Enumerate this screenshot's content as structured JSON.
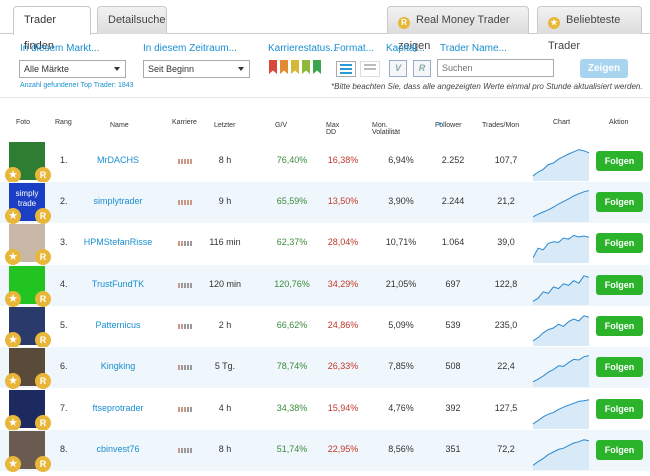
{
  "tabs": {
    "trader_finden": "Trader finden",
    "detailsuche": "Detailsuche",
    "real_money": "Real Money Trader zeigen",
    "beliebteste": "Beliebteste Trader",
    "real_badge": "R"
  },
  "filters": {
    "markt_label": "In diesem Markt...",
    "markt_value": "Alle Märkte",
    "zeitraum_label": "In diesem Zeitraum...",
    "zeitraum_value": "Seit Beginn",
    "karriere_label": "Karrierestatus...",
    "format_label": "Format...",
    "kapital_label": "Kapital...",
    "trader_name_label": "Trader Name...",
    "search_placeholder": "Suchen",
    "zeigen": "Zeigen",
    "anzahl": "Anzahl gefundener Top Trader: 1843",
    "note": "*Bitte beachten Sie, dass alle angezeigten Werte einmal pro Stunde aktualisiert werden.",
    "kapital_v": "V",
    "kapital_r": "R"
  },
  "columns": {
    "foto": "Foto",
    "rang": "Rang",
    "name": "Name",
    "karriere": "Karriere",
    "letzter": "Letzter",
    "gv": "G/V",
    "maxdd": "Max DD",
    "volatil": "Mon. Volatilität",
    "follower": "Follower",
    "trades": "Trades/Mon",
    "chart": "Chart",
    "aktion": "Aktion"
  },
  "rows": [
    {
      "rang": "1.",
      "name": "MrDACHS",
      "letzter": "8 h",
      "gv": "76,40%",
      "maxdd": "16,38%",
      "volatil": "6,94%",
      "follower": "2.252",
      "trades": "107,7",
      "action": "Folgen",
      "photo_color": "#2e7d32"
    },
    {
      "rang": "2.",
      "name": "simplytrader",
      "letzter": "9 h",
      "gv": "65,59%",
      "maxdd": "13,50%",
      "volatil": "3,90%",
      "follower": "2.244",
      "trades": "21,2",
      "action": "Folgen",
      "photo_color": "#1a3fc4",
      "photo_text": "simply trade"
    },
    {
      "rang": "3.",
      "name": "HPMStefanRisse",
      "letzter": "116 min",
      "gv": "62,37%",
      "maxdd": "28,04%",
      "volatil": "10,71%",
      "follower": "1.064",
      "trades": "39,0",
      "action": "Folgen",
      "photo_color": "#c9b8a8"
    },
    {
      "rang": "4.",
      "name": "TrustFundTK",
      "letzter": "120 min",
      "gv": "120,76%",
      "maxdd": "34,29%",
      "volatil": "21,05%",
      "follower": "697",
      "trades": "122,8",
      "action": "Folgen",
      "photo_color": "#22c422"
    },
    {
      "rang": "5.",
      "name": "Patternicus",
      "letzter": "2 h",
      "gv": "66,62%",
      "maxdd": "24,86%",
      "volatil": "5,09%",
      "follower": "539",
      "trades": "235,0",
      "action": "Folgen",
      "photo_color": "#2a3a6a"
    },
    {
      "rang": "6.",
      "name": "Kingking",
      "letzter": "5 Tg.",
      "gv": "78,74%",
      "maxdd": "26,33%",
      "volatil": "7,85%",
      "follower": "508",
      "trades": "22,4",
      "action": "Folgen",
      "photo_color": "#5a4a3a"
    },
    {
      "rang": "7.",
      "name": "ftseprotrader",
      "letzter": "4 h",
      "gv": "34,38%",
      "maxdd": "15,94%",
      "volatil": "4,76%",
      "follower": "392",
      "trades": "127,5",
      "action": "Folgen",
      "photo_color": "#1c2a60"
    },
    {
      "rang": "8.",
      "name": "cbinvest76",
      "letzter": "8 h",
      "gv": "51,74%",
      "maxdd": "22,95%",
      "volatil": "8,56%",
      "follower": "351",
      "trades": "72,2",
      "action": "Folgen",
      "photo_color": "#6b5a50"
    }
  ],
  "colors": {
    "accent": "#1a8fd0",
    "gain": "#3c8a3c",
    "loss": "#c0392b",
    "follow_button": "#2bb32b",
    "badge": "#e8b73a",
    "row_alt": "#eff6fc"
  },
  "icons": [
    "star-icon",
    "real-money-icon",
    "flag-icon",
    "list-format-icon",
    "grid-format-icon",
    "sort-icon"
  ]
}
